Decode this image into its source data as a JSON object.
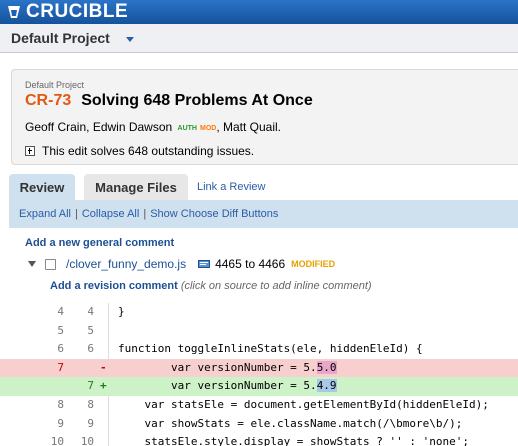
{
  "brand": {
    "name": "CRUCIBLE"
  },
  "project_bar": {
    "name": "Default Project"
  },
  "review": {
    "project": "Default Project",
    "key": "CR-73",
    "title": "Solving 648 Problems At Once",
    "authors": {
      "a1": "Geoff Crain, ",
      "a2": "Edwin Dawson",
      "auth_badge": "AUTH",
      "mod_badge": "MOD",
      "a3": ", Matt Quail."
    },
    "description": "This edit solves 648 outstanding issues."
  },
  "tabs": {
    "review": "Review",
    "manage_files": "Manage Files",
    "link": "Link a Review"
  },
  "toolbar": {
    "expand_all": "Expand All",
    "collapse_all": "Collapse All",
    "show_diff": "Show Choose Diff Buttons",
    "sep": "|"
  },
  "general_comment": "Add a new general comment",
  "file": {
    "name": "/clover_funny_demo.js",
    "revisions": "4465 to 4466",
    "status": "MODIFIED"
  },
  "revision_comment": {
    "label": "Add a revision comment",
    "hint": "(click on source to add inline comment)"
  },
  "code_lines": [
    {
      "l1": "4",
      "l2": "4",
      "mark": "",
      "type": "ctx",
      "text": "}"
    },
    {
      "l1": "5",
      "l2": "5",
      "mark": "",
      "type": "ctx",
      "text": ""
    },
    {
      "l1": "6",
      "l2": "6",
      "mark": "",
      "type": "ctx",
      "text": "function toggleInlineStats(ele, hiddenEleId) {"
    },
    {
      "l1": "7",
      "l2": "",
      "mark": "-",
      "type": "del",
      "text_pre": "        var versionNumber = 5.",
      "text_hl": "5.0",
      "text_post": ""
    },
    {
      "l1": "",
      "l2": "7",
      "mark": "+",
      "type": "add",
      "text_pre": "        var versionNumber = 5.",
      "text_hl": "4.9",
      "text_post": ""
    },
    {
      "l1": "8",
      "l2": "8",
      "mark": "",
      "type": "ctx",
      "text": "    var statsEle = document.getElementById(hiddenEleId);"
    },
    {
      "l1": "9",
      "l2": "9",
      "mark": "",
      "type": "ctx",
      "text": "    var showStats = ele.className.match(/\\bmore\\b/);"
    },
    {
      "l1": "10",
      "l2": "10",
      "mark": "",
      "type": "ctx",
      "text": "    statsEle.style.display = showStats ? '' : 'none';"
    }
  ],
  "colors": {
    "brand_bar": "#1c61b3",
    "review_key": "#e05a14",
    "deleted_bg": "#f8cfcf",
    "added_bg": "#cdf2c8"
  },
  "icons": {
    "logo": "crucible-logo-icon",
    "expand": "plus-box-icon",
    "file_toggle": "triangle-down-icon",
    "revision": "revision-icon"
  }
}
